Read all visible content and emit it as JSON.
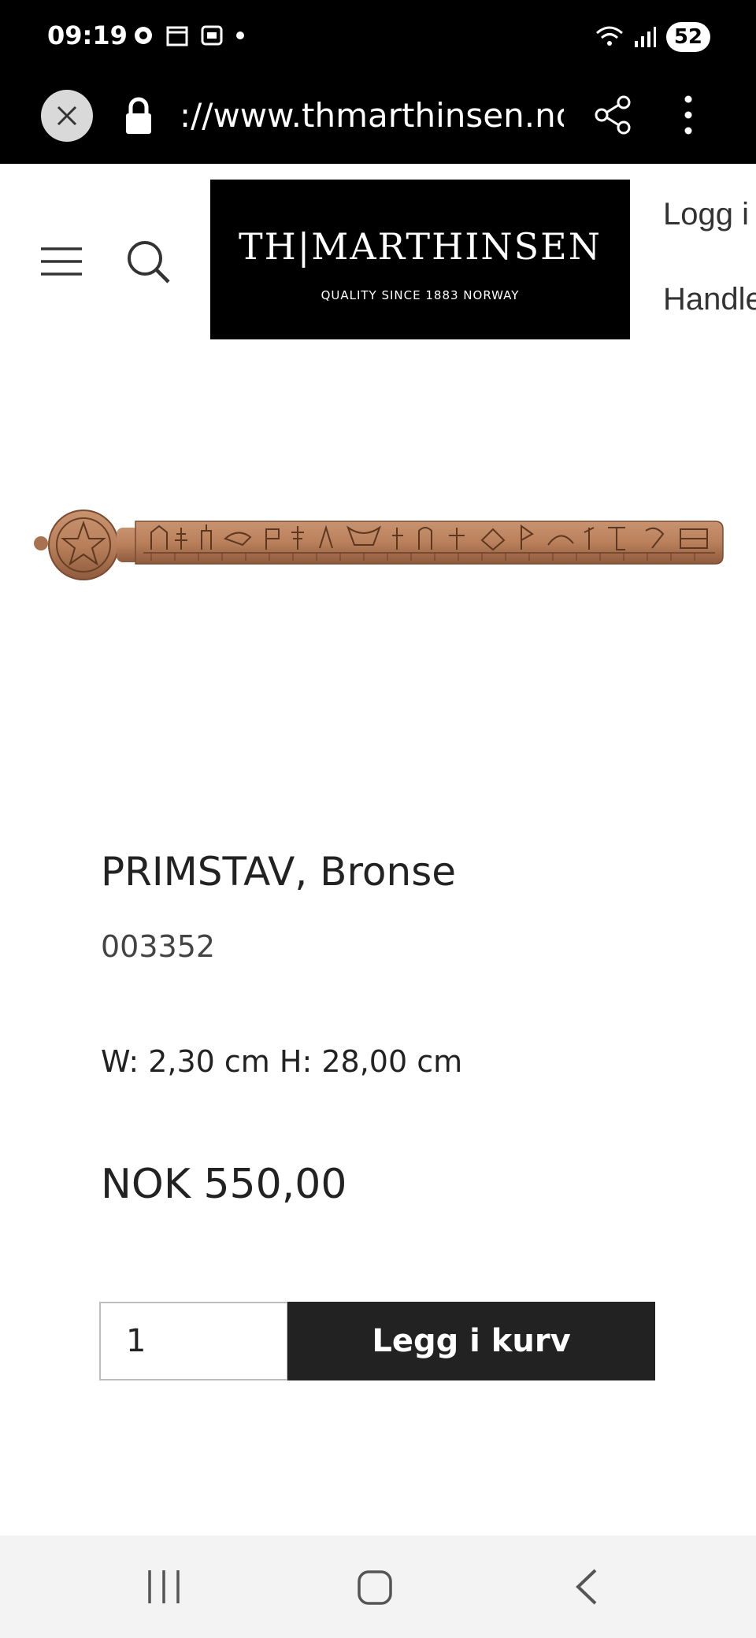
{
  "status_bar": {
    "time": "09:19",
    "battery": "52"
  },
  "url_bar": {
    "url": "://www.thmarthinsen.no/p"
  },
  "header": {
    "logo_name": "TH|MARTHINSEN",
    "logo_tagline": "QUALITY SINCE 1883   NORWAY",
    "login_label": "Logg i",
    "cart_label": "Handle"
  },
  "product": {
    "title": "PRIMSTAV, Bronse",
    "sku": "003352",
    "dimensions": "W: 2,30 cm H: 28,00 cm",
    "price": "NOK 550,00",
    "quantity": "1",
    "add_to_cart_label": "Legg i kurv"
  },
  "colors": {
    "bronze": "#b9805b",
    "dark_button": "#222222"
  }
}
